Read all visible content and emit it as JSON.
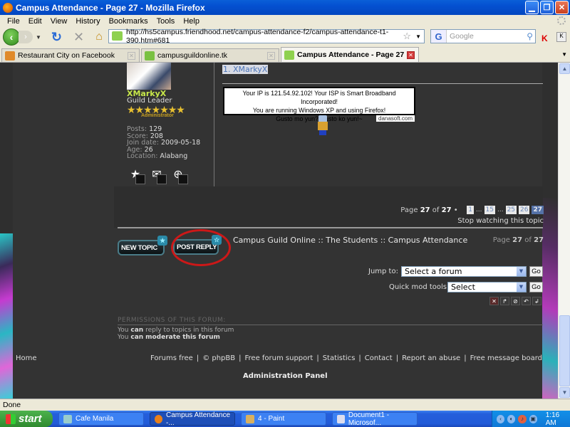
{
  "window": {
    "title": "Campus Attendance - Page 27 - Mozilla Firefox",
    "controls": [
      "minimize",
      "restore",
      "close"
    ]
  },
  "menu": [
    "File",
    "Edit",
    "View",
    "History",
    "Bookmarks",
    "Tools",
    "Help"
  ],
  "nav": {
    "url": "http://hs5campus.friendhood.net/campus-attendance-f2/campus-attendance-t1-390.htm#681",
    "search_placeholder": "Google",
    "search_engine_letter": "G"
  },
  "tabs": [
    {
      "label": "Restaurant City on Facebook",
      "active": false,
      "icon_color": "#e08a2a"
    },
    {
      "label": "campusguildonline.tk",
      "active": false,
      "icon_color": "#7ac142"
    },
    {
      "label": "Campus Attendance - Page 27",
      "active": true,
      "icon_color": "#8fd14f"
    }
  ],
  "profile": {
    "username": "XMarkyX",
    "rank": "Guild Leader",
    "stars": "★★★★★★★",
    "role_label": "Administrator",
    "stats": [
      {
        "key": "Posts",
        "value": "129"
      },
      {
        "key": "Score",
        "value": "208"
      },
      {
        "key": "Join date",
        "value": "2009-05-18"
      },
      {
        "key": "Age",
        "value": "26"
      },
      {
        "key": "Location",
        "value": "Alabang"
      }
    ]
  },
  "post": {
    "title": "1. XMarkyX",
    "signature_lines": [
      "Your IP is 121.54.92.102! Your ISP is Smart Broadband Incorporated!",
      "You are running Windows XP and using Firefox!",
      "Gusto mo yun? Gusto ko yun!~"
    ],
    "signature_credit": "danasoft.com"
  },
  "pagination": {
    "label_prefix": "Page",
    "current": "27",
    "of": "of",
    "total": "27",
    "bullet": "•",
    "pages": [
      "1",
      "...",
      "15",
      "...",
      "25",
      "26",
      "27"
    ],
    "stop_watching": "Stop watching this topic"
  },
  "actions": {
    "new_topic": "NEW TOPIC",
    "post_reply": "POST REPLY"
  },
  "breadcrumb": "Campus Guild Online :: The Students :: Campus Attendance",
  "page_of": {
    "prefix": "Page",
    "current": "27",
    "of": "of",
    "total": "27"
  },
  "jump": {
    "label": "Jump to:",
    "selected": "Select a forum",
    "go": "Go"
  },
  "quick_mod": {
    "label": "Quick mod tools:",
    "selected": "Select",
    "go": "Go"
  },
  "mod_icons": [
    "delete-icon",
    "move-icon",
    "lock-icon",
    "split-icon",
    "merge-icon"
  ],
  "permissions": {
    "title": "PERMISSIONS OF THIS FORUM:",
    "lines": [
      {
        "pre": "You",
        "can": "can",
        "rest": "reply to topics in this forum"
      },
      {
        "pre": "You",
        "can": "can",
        "rest": "moderate this forum"
      }
    ]
  },
  "footer": {
    "home": "Home",
    "links": [
      "Forums free",
      "© phpBB",
      "Free forum support",
      "Statistics",
      "Contact",
      "Report an abuse",
      "Free message board"
    ],
    "admin_panel": "Administration Panel"
  },
  "status": "Done",
  "taskbar": {
    "start": "start",
    "tasks": [
      {
        "label": "Cafe Manila",
        "active": false
      },
      {
        "label": "Campus Attendance -...",
        "active": true
      },
      {
        "label": "4 - Paint",
        "active": false
      },
      {
        "label": "Document1 - Microsof...",
        "active": false
      }
    ],
    "clock": "1:16 AM"
  },
  "colors": {
    "page_bg": "#333333",
    "username": "#c8e84a",
    "link_blue": "#4b74b8",
    "highlight_circle": "#cc1818",
    "xp_blue": "#245edb"
  }
}
